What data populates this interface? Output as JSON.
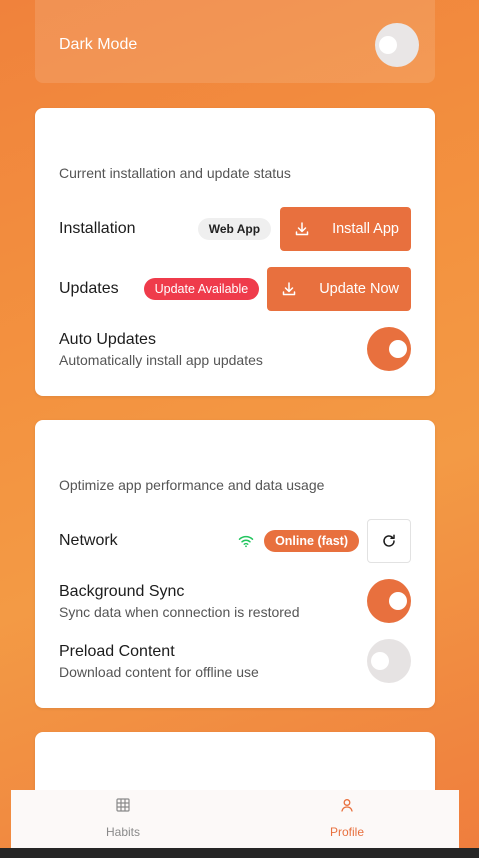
{
  "appearance": {
    "dark_mode_label": "Dark Mode",
    "dark_mode_on": false
  },
  "install_card": {
    "subtitle": "Current installation and update status",
    "installation_label": "Installation",
    "installation_badge": "Web App",
    "install_button": "Install App",
    "updates_label": "Updates",
    "updates_badge": "Update Available",
    "update_button": "Update Now",
    "auto_updates_label": "Auto Updates",
    "auto_updates_desc": "Automatically install app updates",
    "auto_updates_on": true
  },
  "performance_card": {
    "subtitle": "Optimize app performance and data usage",
    "network_label": "Network",
    "network_badge": "Online (fast)",
    "background_sync_label": "Background Sync",
    "background_sync_desc": "Sync data when connection is restored",
    "background_sync_on": true,
    "preload_label": "Preload Content",
    "preload_desc": "Download content for offline use",
    "preload_on": false
  },
  "nav": {
    "habits_label": "Habits",
    "profile_label": "Profile",
    "active": "Profile"
  },
  "colors": {
    "accent": "#e8703e",
    "alert": "#ef3b4b",
    "wifi": "#22c55e"
  }
}
